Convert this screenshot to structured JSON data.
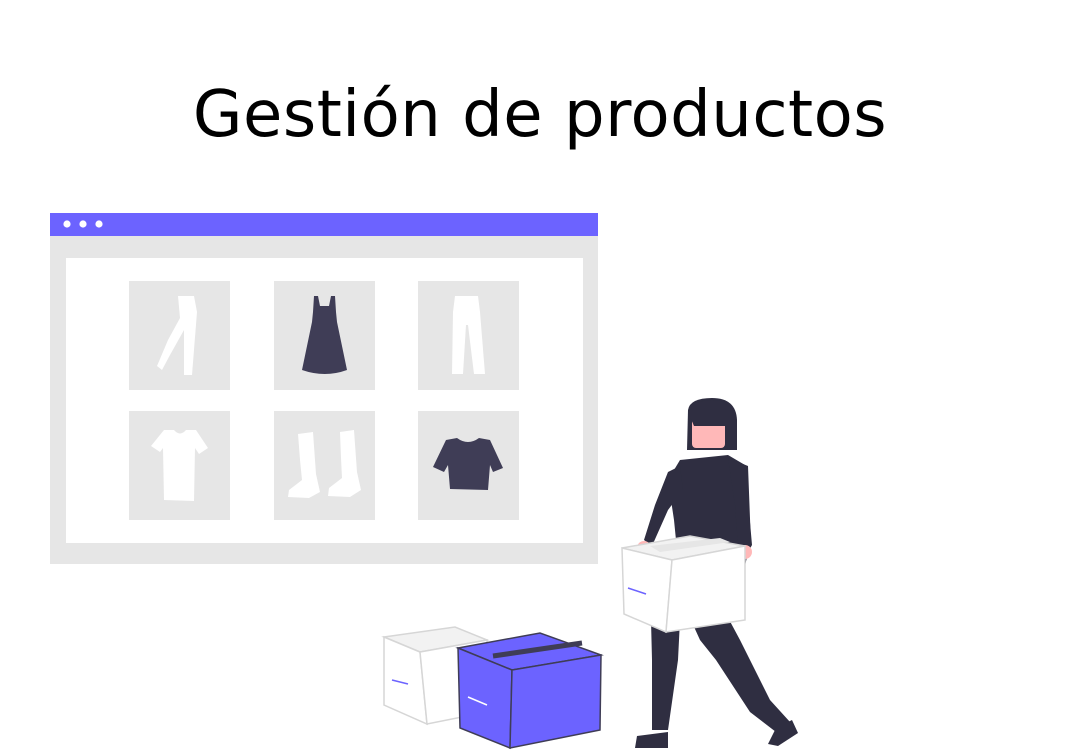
{
  "page": {
    "title": "Gestión de productos"
  },
  "illustration": {
    "browser_window": {
      "traffic_dots": 3,
      "products": [
        {
          "icon": "pants-icon"
        },
        {
          "icon": "dress-icon"
        },
        {
          "icon": "trousers-icon"
        },
        {
          "icon": "tshirt-icon"
        },
        {
          "icon": "boots-icon"
        },
        {
          "icon": "crop-top-icon"
        }
      ]
    },
    "person": "person-carrying-box",
    "boxes": [
      "white-box",
      "purple-box"
    ]
  },
  "colors": {
    "accent": "#6c63ff",
    "dark": "#3f3d56",
    "panel": "#e6e6e6",
    "skin": "#ffb8b8",
    "hair": "#2f2e41"
  }
}
